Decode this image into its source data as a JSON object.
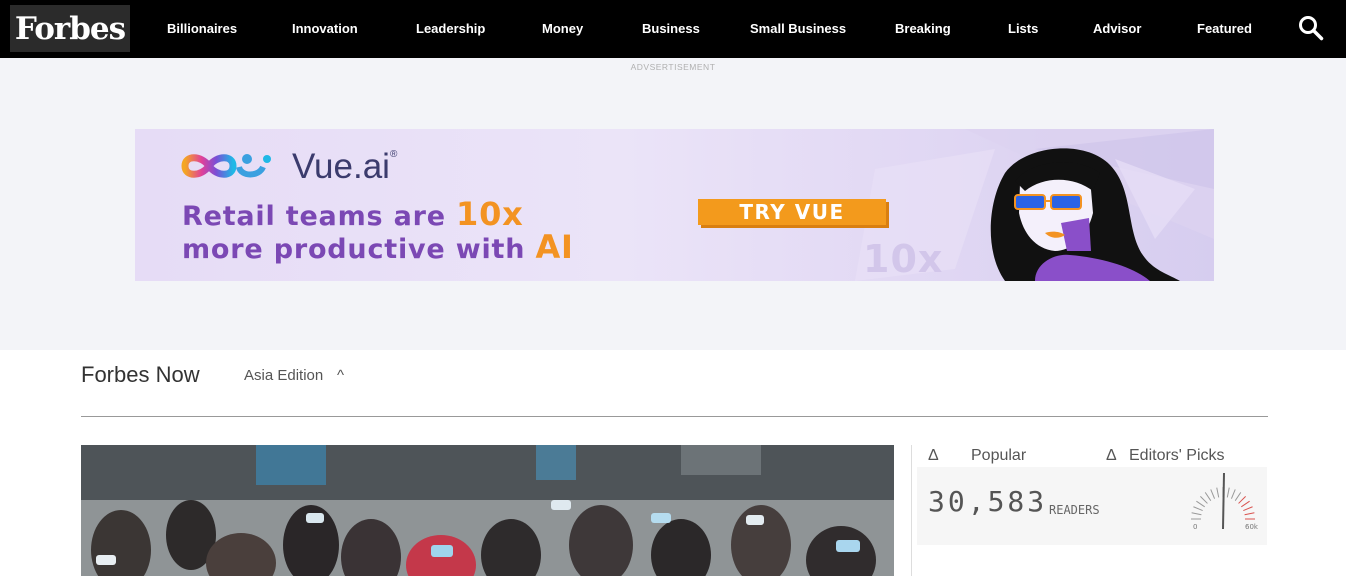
{
  "nav": {
    "logo": "Forbes",
    "items": [
      "Billionaires",
      "Innovation",
      "Leadership",
      "Money",
      "Business",
      "Small Business",
      "Breaking",
      "Lists",
      "Advisor",
      "Featured"
    ],
    "search_icon": "search-icon"
  },
  "ad": {
    "label": "ADVSERTISEMENT",
    "brand": "Vue.ai",
    "headline_line1": "Retail teams are",
    "headline_hl1": "10x",
    "headline_line2": "more productive with",
    "headline_hl2": "AI",
    "cta": "TRY VUE",
    "watermark": "10x",
    "colors": {
      "purple": "#7b48b4",
      "orange": "#f39322"
    }
  },
  "section": {
    "title": "Forbes Now",
    "edition": "Asia Edition",
    "caret": "^"
  },
  "sidebar": {
    "tabs": [
      {
        "icon": "Δ",
        "label": "Popular"
      },
      {
        "icon": "Δ",
        "label": "Editors' Picks"
      }
    ],
    "readers_count": "30,583",
    "readers_label": "READERS",
    "gauge_min": "0",
    "gauge_max": "60k"
  }
}
